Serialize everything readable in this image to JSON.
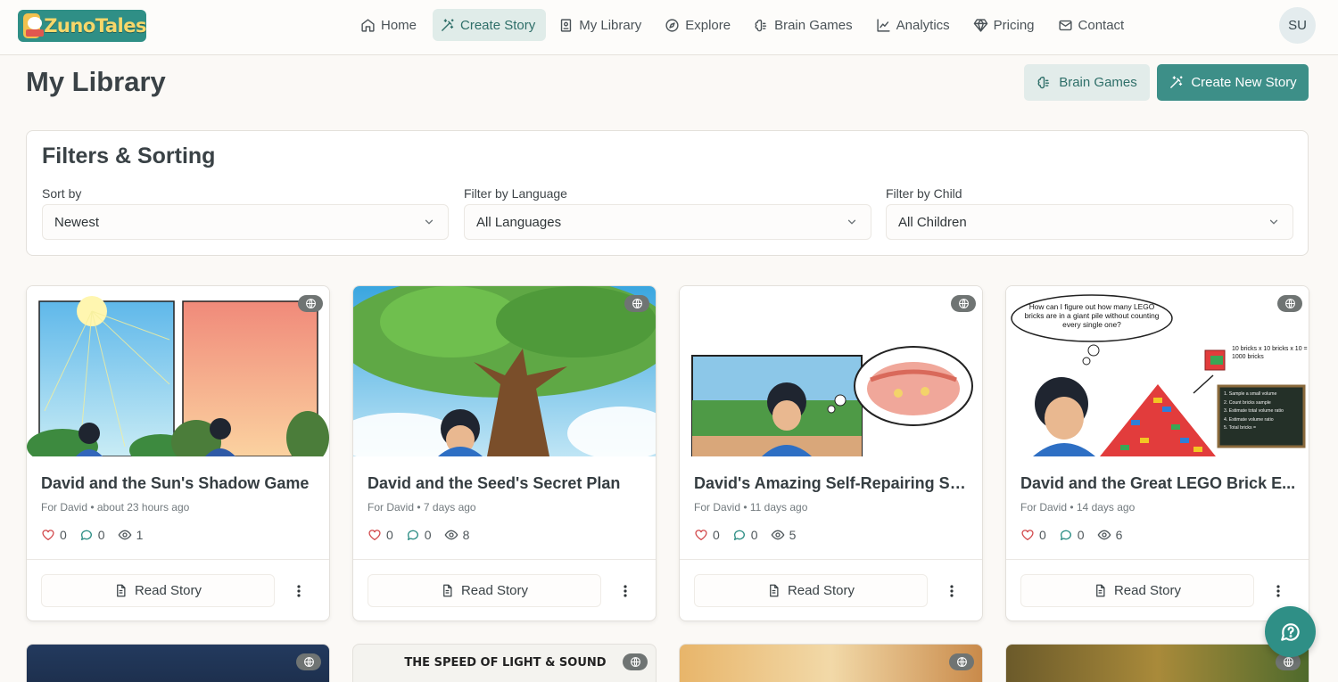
{
  "app": {
    "logo_text": "ZunoTales",
    "accent": "#3d8f88"
  },
  "nav": {
    "items": [
      {
        "label": "Home",
        "icon": "home-icon"
      },
      {
        "label": "Create Story",
        "icon": "magic-wand-icon",
        "active": true
      },
      {
        "label": "My Library",
        "icon": "book-icon"
      },
      {
        "label": "Explore",
        "icon": "compass-icon"
      },
      {
        "label": "Brain Games",
        "icon": "brain-icon"
      },
      {
        "label": "Analytics",
        "icon": "chart-icon"
      },
      {
        "label": "Pricing",
        "icon": "gem-icon"
      },
      {
        "label": "Contact",
        "icon": "mail-icon"
      }
    ],
    "avatar_initials": "SU"
  },
  "header": {
    "title": "My Library",
    "brain_games_label": "Brain Games",
    "create_label": "Create New Story"
  },
  "filters": {
    "title": "Filters & Sorting",
    "sort": {
      "label": "Sort by",
      "value": "Newest"
    },
    "language": {
      "label": "Filter by Language",
      "value": "All Languages"
    },
    "child": {
      "label": "Filter by Child",
      "value": "All Children"
    }
  },
  "stories": [
    {
      "title": "David and the Sun's Shadow Game",
      "meta": "For David • about 23 hours ago",
      "likes": "0",
      "comments": "0",
      "views": "1",
      "read_label": "Read Story"
    },
    {
      "title": "David and the Seed's Secret Plan",
      "meta": "For David • 7 days ago",
      "likes": "0",
      "comments": "0",
      "views": "8",
      "read_label": "Read Story"
    },
    {
      "title": "David's Amazing Self-Repairing Skin",
      "meta": "For David • 11 days ago",
      "likes": "0",
      "comments": "0",
      "views": "5",
      "read_label": "Read Story"
    },
    {
      "title": "David and the Great LEGO Brick E...",
      "meta": "For David • 14 days ago",
      "likes": "0",
      "comments": "0",
      "views": "6",
      "read_label": "Read Story"
    }
  ],
  "illustrations": {
    "lego_thought": "How can I figure out how many LEGO bricks are in a giant pile without counting every single one?",
    "lego_formula": "10 bricks x 10 bricks x 10 = 1000 bricks",
    "lego_board": [
      "1. Sample a small volume",
      "2. Count bricks sample",
      "3. Estimate total volume ratio",
      "4. Estimate volume ratio",
      "5. Total bricks ="
    ],
    "next_row_title": "THE SPEED OF LIGHT & SOUND"
  }
}
